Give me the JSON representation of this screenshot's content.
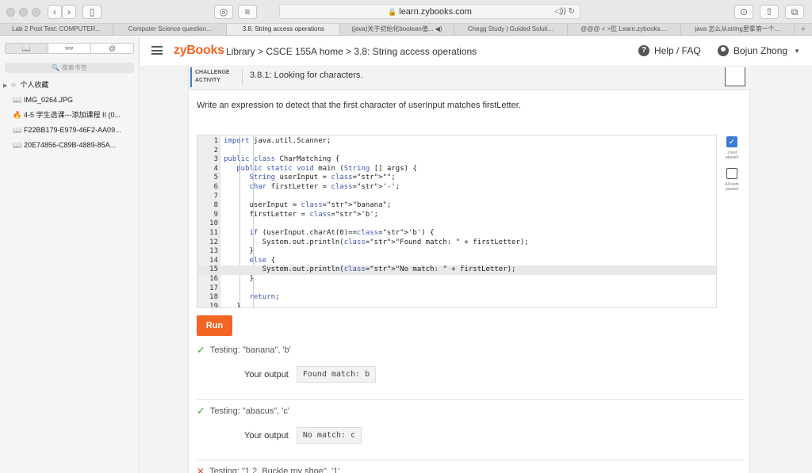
{
  "browser": {
    "url": "learn.zybooks.com",
    "tabs": [
      "Lab 2 Post Test: COMPUTER...",
      "Computer Science question...",
      "3.8. String access operations",
      "(java)关于初始化boolean值... ◀)",
      "Chegg Study | Guided Soluti...",
      "@@@ < >肛 Learn.zybooks....",
      "java 怎么从string里拿第一个..."
    ],
    "active_tab": 2,
    "plus": "+"
  },
  "sidebar": {
    "segments": [
      "📖",
      "👓",
      "@"
    ],
    "search_placeholder": "🔍 搜索书签",
    "items": [
      {
        "icon": "☆",
        "label": "个人收藏"
      },
      {
        "icon": "📖",
        "label": "IMG_0264.JPG"
      },
      {
        "icon": "🔥",
        "label": "4-5 学生选课---添加课程 II (0..."
      },
      {
        "icon": "📖",
        "label": "F22BB179-E979-46F2-AA09..."
      },
      {
        "icon": "📖",
        "label": "20E74856-C89B-4889-85A..."
      }
    ]
  },
  "header": {
    "logo": "zyBooks",
    "breadcrumb": "Library > CSCE 155A home > 3.8: String access operations",
    "help": "Help / FAQ",
    "user": "Bojun Zhong"
  },
  "activity": {
    "badge_line1": "CHALLENGE",
    "badge_line2": "ACTIVITY",
    "title": "3.8.1: Looking for characters.",
    "prompt": "Write an expression to detect that the first character of userInput matches firstLetter."
  },
  "code": {
    "lines": [
      "import java.util.Scanner;",
      "",
      "public class CharMatching {",
      "   public static void main (String [] args) {",
      "      String userInput = \"\";",
      "      char firstLetter = '-';",
      "",
      "      userInput = \"banana\";",
      "      firstLetter = 'b';",
      "",
      "      if (userInput.charAt(0)=='b') {",
      "         System.out.println(\"Found match: \" + firstLetter);",
      "      }",
      "      else {",
      "         System.out.println(\"No match: \" + firstLetter);",
      "      }",
      "",
      "      return;",
      "   }"
    ],
    "highlighted_line": 15
  },
  "status": {
    "test1_caption": "1 test passed",
    "test2_caption": "All tests passed"
  },
  "run_label": "Run",
  "tests": [
    {
      "label": "Testing: \"banana\", 'b'",
      "passed": true,
      "output_label": "Your output",
      "output": "Found match: b"
    },
    {
      "label": "Testing: \"abacus\", 'c'",
      "passed": true,
      "output_label": "Your output",
      "output": "No match: c"
    },
    {
      "label": "Testing: \"1 2, Buckle my shoe\", '1'",
      "passed": false
    }
  ],
  "colors": {
    "brand": "#f26522",
    "pass": "#3aa94b",
    "fail": "#e05050",
    "accent": "#3a7bd5"
  }
}
